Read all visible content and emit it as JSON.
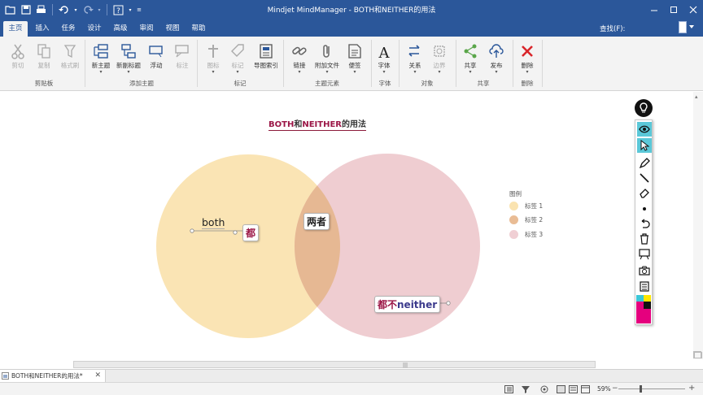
{
  "window": {
    "title": "Mindjet MindManager - BOTH和NEITHER的用法"
  },
  "menu_tabs": [
    "主页",
    "插入",
    "任务",
    "设计",
    "高级",
    "审阅",
    "视图",
    "帮助"
  ],
  "search": {
    "label": "查找(F):"
  },
  "ribbon": {
    "buttons": [
      "剪切",
      "复制",
      "格式刷",
      "新主题",
      "新副标题",
      "浮动",
      "标注",
      "图标",
      "标记",
      "导图索引",
      "链接",
      "附加文件",
      "便签",
      "字体",
      "关系",
      "边界",
      "共享",
      "发布",
      "删除"
    ],
    "groups": [
      "剪贴板",
      "添加主题",
      "标记",
      "主题元素",
      "字体",
      "对象",
      "共享",
      "删除"
    ]
  },
  "map": {
    "title_parts": [
      "BOTH",
      "和",
      "NEITHER",
      "的用法"
    ],
    "topics": {
      "both": "both",
      "du": "都",
      "liangzhe": "两者",
      "dubu": "都不",
      "neither": "neither"
    }
  },
  "legend": {
    "title": "图例",
    "items": [
      {
        "label": "标签 1",
        "color": "#fae3b0"
      },
      {
        "label": "标签 2",
        "color": "#e9bc95"
      },
      {
        "label": "标签 3",
        "color": "#f0cfd4"
      }
    ]
  },
  "colors": {
    "titlebar": "#2b579a",
    "circle_left": "#fae3b0",
    "circle_right": "#ebc0c6",
    "overlap": "#e6b893",
    "accent_red": "#9b1646",
    "neither_blue": "#3b3a8c"
  },
  "doc_tab": {
    "name": "BOTH和NEITHER的用法*"
  },
  "status": {
    "zoom": "59%"
  }
}
